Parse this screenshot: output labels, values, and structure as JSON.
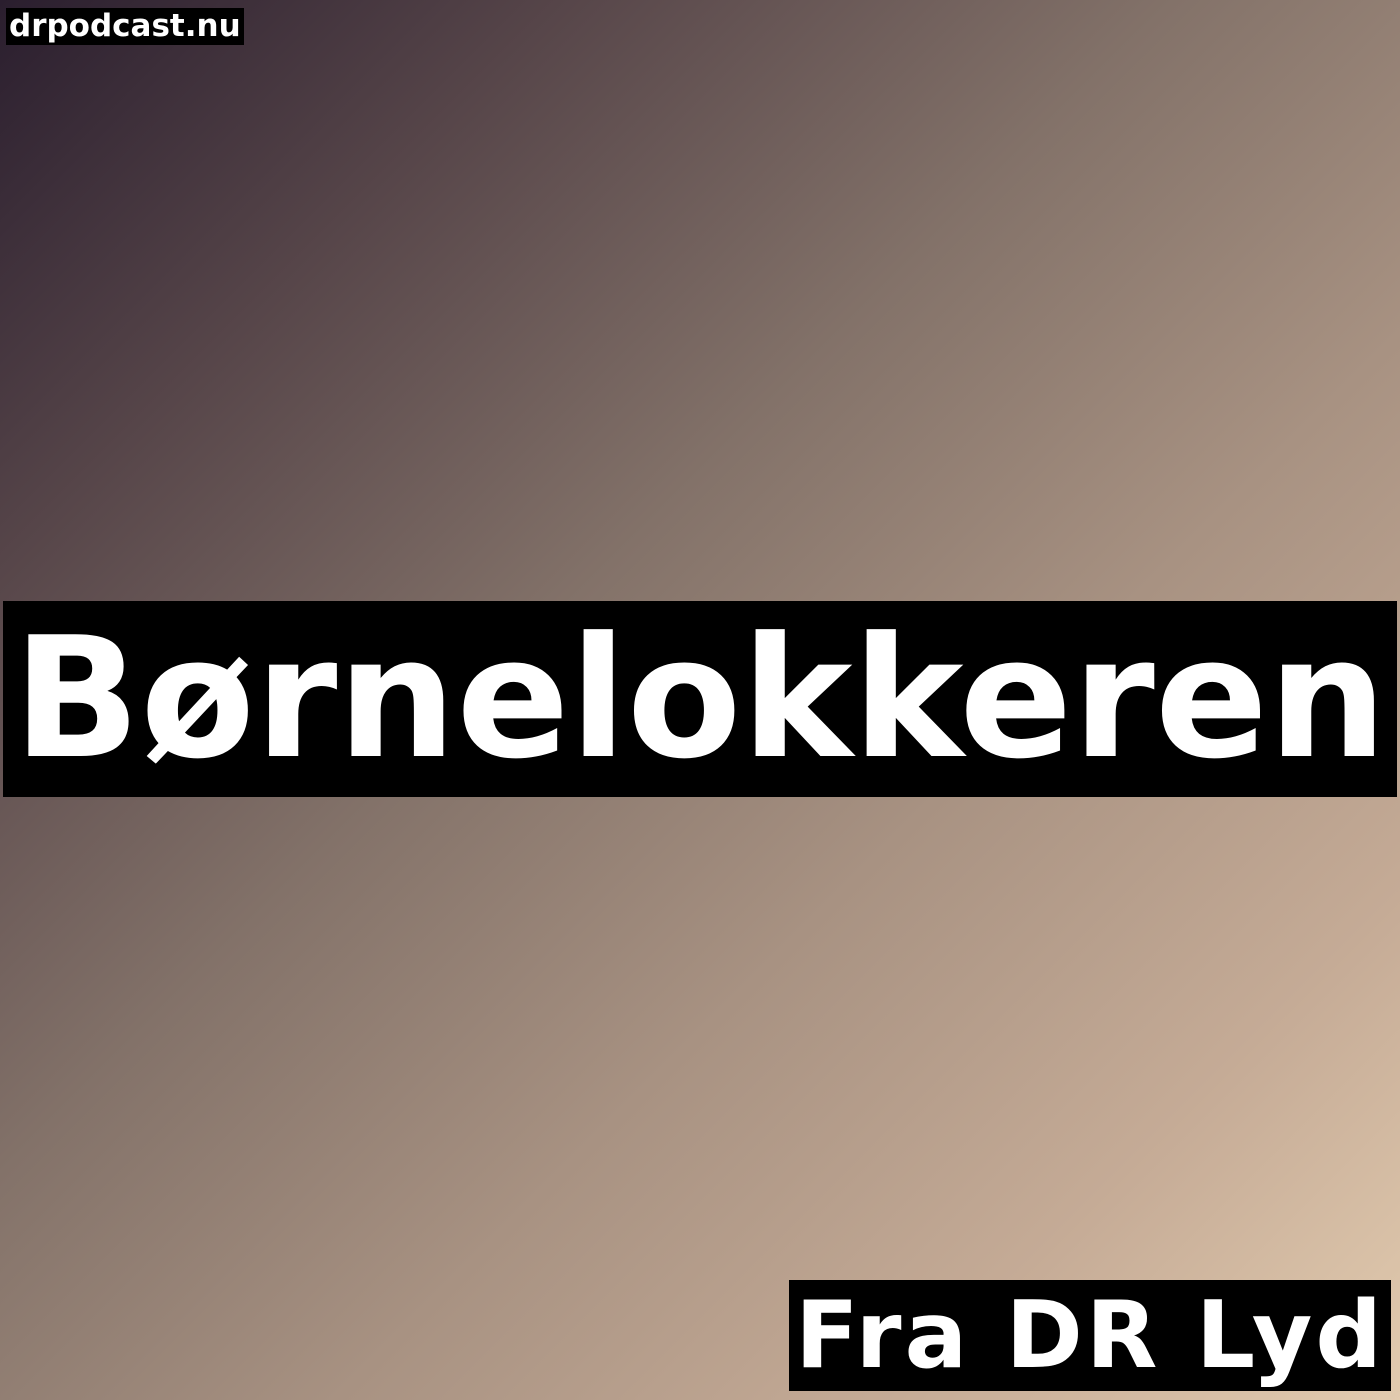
{
  "site": {
    "label": "drpodcast.nu"
  },
  "podcast": {
    "title": "Børnelokkeren",
    "source": "Fra DR Lyd"
  },
  "colors": {
    "gradient_start": "#2a1e2e",
    "gradient_end": "#e2cbaf",
    "label_background": "#000000",
    "label_text": "#ffffff"
  }
}
